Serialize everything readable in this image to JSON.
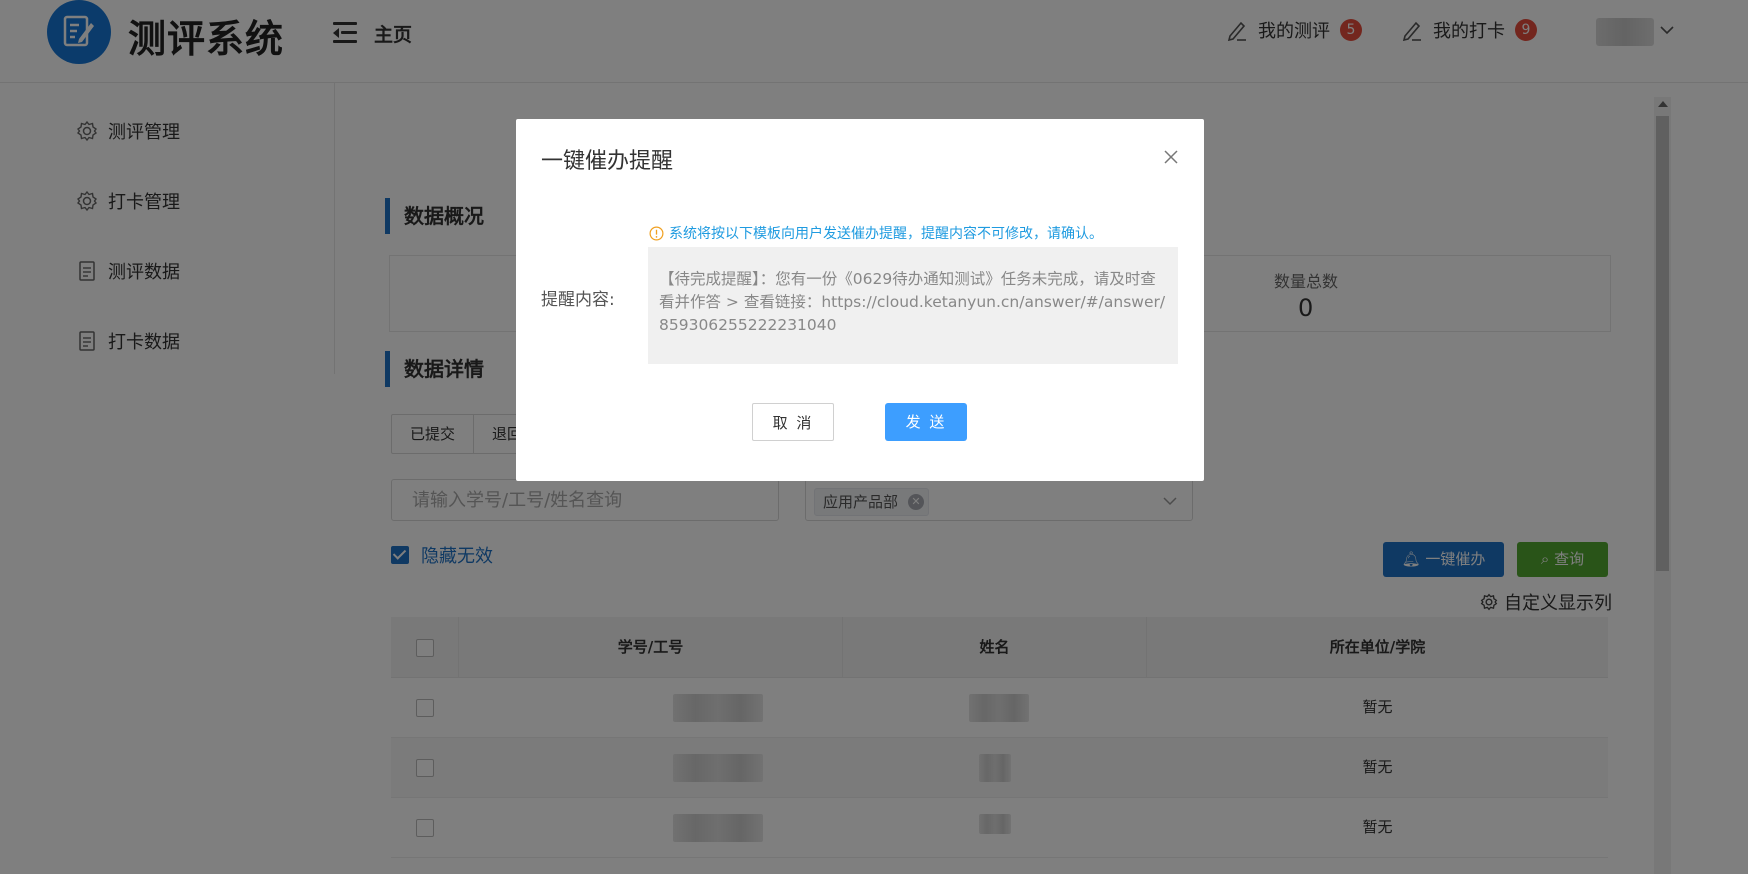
{
  "header": {
    "app_title": "测评系统",
    "home": "主页",
    "my_evaluation": "我的测评",
    "my_evaluation_count": "5",
    "my_checkin": "我的打卡",
    "my_checkin_count": "9",
    "logo_icon": "edit-document-icon",
    "accent": "#1677d6",
    "badge_color": "#e74c3c"
  },
  "sidebar": {
    "items": [
      {
        "label": "测评管理",
        "icon": "gear-icon"
      },
      {
        "label": "打卡管理",
        "icon": "gear-icon"
      },
      {
        "label": "测评数据",
        "icon": "document-icon"
      },
      {
        "label": "打卡数据",
        "icon": "document-icon"
      }
    ]
  },
  "main": {
    "overview_title": "数据概况",
    "total_label": "数量总数",
    "total_value": "0",
    "details_title": "数据详情",
    "tabs": [
      "已提交",
      "退回"
    ],
    "search_placeholder": "请输入学号/工号/姓名查询",
    "filter_tag": "应用产品部",
    "hide_invalid": "隐藏无效",
    "urge_button": "一键催办",
    "query_button": "查询",
    "custom_columns": "自定义显示列",
    "table": {
      "columns": [
        "学号/工号",
        "姓名",
        "所在单位/学院"
      ],
      "rows": [
        {
          "unit": "暂无"
        },
        {
          "unit": "暂无"
        },
        {
          "unit": "暂无"
        }
      ]
    }
  },
  "modal": {
    "title": "一键催办提醒",
    "notice": "系统将按以下模板向用户发送催办提醒，提醒内容不可修改，请确认。",
    "content_label": "提醒内容:",
    "content_text": "【待完成提醒】：您有一份《0629待办通知测试》任务未完成，请及时查看并作答 > 查看链接：https://cloud.ketanyun.cn/answer/#/answer/859306255222231040",
    "cancel": "取 消",
    "send": "发 送",
    "send_color": "#3d9eff",
    "notice_color": "#1f9be0"
  }
}
